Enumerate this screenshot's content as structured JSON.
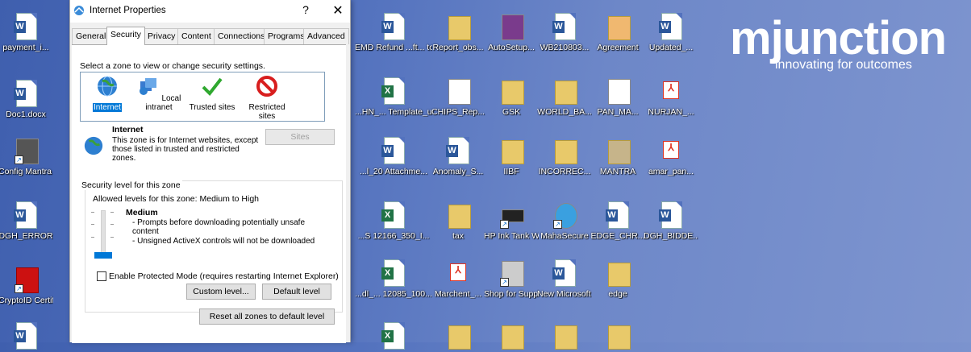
{
  "desktop": {
    "icons": [
      {
        "label": "payment_i...",
        "type": "word"
      },
      {
        "label": "Doc1.docx",
        "type": "word"
      },
      {
        "label": "Config Mantra ...",
        "type": "generic"
      },
      {
        "label": "DGH_ERROR",
        "type": "word"
      },
      {
        "label": "CryptoID Certifica...",
        "type": "generic"
      },
      {
        "label": "EMD Refund ...ft... to unsuccessf...",
        "type": "word"
      },
      {
        "label": "Report_obs...",
        "type": "folder"
      },
      {
        "label": "AutoSetup...",
        "type": "generic"
      },
      {
        "label": "WB210803...",
        "type": "word"
      },
      {
        "label": "Agreement",
        "type": "folder"
      },
      {
        "label": "Updated_...",
        "type": "word"
      },
      {
        "label": "...HN_... Template_u...",
        "type": "excel"
      },
      {
        "label": "CHIPS_Rep...",
        "type": "generic"
      },
      {
        "label": "GSK",
        "type": "folder"
      },
      {
        "label": "WORLD_BA...",
        "type": "folder"
      },
      {
        "label": "PAN_MA...",
        "type": "generic"
      },
      {
        "label": "NURJAN_...",
        "type": "pdf"
      },
      {
        "label": "...l_20 Attachme...",
        "type": "word"
      },
      {
        "label": "Anomaly_S...",
        "type": "word"
      },
      {
        "label": "IIBF",
        "type": "folder"
      },
      {
        "label": "INCORREC...",
        "type": "folder"
      },
      {
        "label": "MANTRA",
        "type": "folder"
      },
      {
        "label": "amar_pan...",
        "type": "pdf"
      },
      {
        "label": "...S 12166_350_I...",
        "type": "excel"
      },
      {
        "label": "tax",
        "type": "folder"
      },
      {
        "label": "HP Ink Tank Wireless 4...",
        "type": "generic"
      },
      {
        "label": "MahaSecure",
        "type": "generic"
      },
      {
        "label": "EDGE_CHR...",
        "type": "word"
      },
      {
        "label": "DGH_BIDDE...",
        "type": "word"
      },
      {
        "label": "...dl_... 12085_100...",
        "type": "excel"
      },
      {
        "label": "Marchent_...",
        "type": "pdf"
      },
      {
        "label": "Shop for Supplies - ...",
        "type": "generic"
      },
      {
        "label": "New Microsoft ...",
        "type": "word"
      },
      {
        "label": "edge",
        "type": "folder"
      }
    ]
  },
  "logo": {
    "brand": "mjunction",
    "tagline": "innovating for outcomes"
  },
  "dialog": {
    "title": "Internet Properties",
    "help": "?",
    "close": "✕",
    "tabs": [
      "General",
      "Security",
      "Privacy",
      "Content",
      "Connections",
      "Programs",
      "Advanced"
    ],
    "active_tab": "Security",
    "instruction": "Select a zone to view or change security settings.",
    "zones": [
      {
        "label": "Internet",
        "icon": "globe-icon"
      },
      {
        "label": "Local intranet",
        "icon": "network-icon"
      },
      {
        "label": "Trusted sites",
        "icon": "checkmark-icon"
      },
      {
        "label": "Restricted sites",
        "icon": "blocked-icon"
      }
    ],
    "selected_zone": "Internet",
    "zone_title": "Internet",
    "zone_desc": "This zone is for Internet websites, except those listed in trusted and restricted zones.",
    "sites_btn": "Sites",
    "security_level_legend": "Security level for this zone",
    "allowed_levels": "Allowed levels for this zone: Medium to High",
    "level_name": "Medium",
    "level_bullets": [
      "- Prompts before downloading potentially unsafe content",
      "- Unsigned ActiveX controls will not be downloaded"
    ],
    "protected_mode": "Enable Protected Mode (requires restarting Internet Explorer)",
    "protected_mode_checked": false,
    "custom_level_btn": "Custom level...",
    "default_level_btn": "Default level",
    "reset_all_btn": "Reset all zones to default level"
  }
}
